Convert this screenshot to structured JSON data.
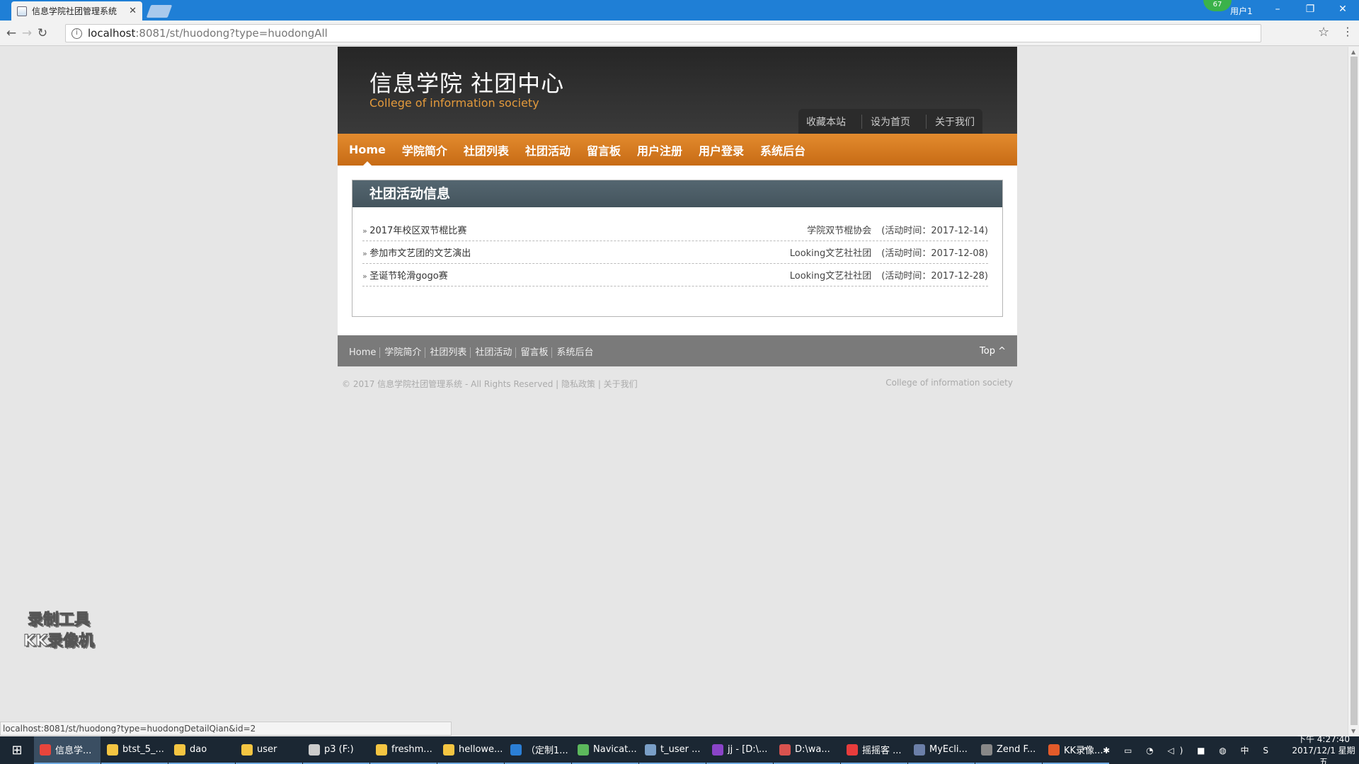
{
  "browser": {
    "tab_title": "信息学院社团管理系统",
    "tab_close": "✕",
    "url_host": "localhost",
    "url_path": ":8081/st/huodong?type=huodongAll",
    "user_badge": "67",
    "user_label": "用户1",
    "status_url": "localhost:8081/st/huodong?type=huodongDetailQian&id=2"
  },
  "site": {
    "title": "信息学院 社团中心",
    "subtitle": "College of information society",
    "top_links": [
      "收藏本站",
      "设为首页",
      "关于我们"
    ],
    "nav": [
      "Home",
      "学院简介",
      "社团列表",
      "社团活动",
      "留言板",
      "用户注册",
      "用户登录",
      "系统后台"
    ],
    "panel_title": "社团活动信息",
    "activities": [
      {
        "name": "2017年校区双节棍比赛",
        "club": "学院双节棍协会",
        "time": "(活动时间：2017-12-14)"
      },
      {
        "name": "参加市文艺团的文艺演出",
        "club": "Looking文艺社社团",
        "time": "(活动时间：2017-12-08)"
      },
      {
        "name": "圣诞节轮滑gogo赛",
        "club": "Looking文艺社社团",
        "time": "(活动时间：2017-12-28)"
      }
    ],
    "footer_links": [
      "Home",
      "学院简介",
      "社团列表",
      "社团活动",
      "留言板",
      "系统后台"
    ],
    "footer_top": "Top ^",
    "copyright": "© 2017 信息学院社团管理系统 - All Rights Reserved  |  隐私政策  |  关于我们",
    "copyright_right": "College of information society"
  },
  "watermark": [
    "录制工具",
    "KK录像机"
  ],
  "taskbar": {
    "items": [
      {
        "label": "信息学...",
        "color": "#e8453c"
      },
      {
        "label": "btst_5_...",
        "color": "#f4c542"
      },
      {
        "label": "dao",
        "color": "#f4c542"
      },
      {
        "label": "user",
        "color": "#f4c542"
      },
      {
        "label": "p3 (F:)",
        "color": "#cccccc"
      },
      {
        "label": "freshm...",
        "color": "#f4c542"
      },
      {
        "label": "hellowe...",
        "color": "#f4c542"
      },
      {
        "label": "（定制1...",
        "color": "#2b7fd6"
      },
      {
        "label": "Navicat...",
        "color": "#5cb85c"
      },
      {
        "label": "t_user ...",
        "color": "#7a9fc7"
      },
      {
        "label": "jj - [D:\\...",
        "color": "#8a44c8"
      },
      {
        "label": "D:\\wa...",
        "color": "#d9534f"
      },
      {
        "label": "摇摇客 ...",
        "color": "#e83c3c"
      },
      {
        "label": "MyEcli...",
        "color": "#6b7fa8"
      },
      {
        "label": "Zend F...",
        "color": "#888888"
      },
      {
        "label": "KK录像...",
        "color": "#e35b2a"
      }
    ],
    "clock_time": "下午 4:27:40",
    "clock_date": "2017/12/1 星期五",
    "tray_icons": "^ ✱ ▭ ◔ ◁) ■ ◍ 中 S"
  }
}
